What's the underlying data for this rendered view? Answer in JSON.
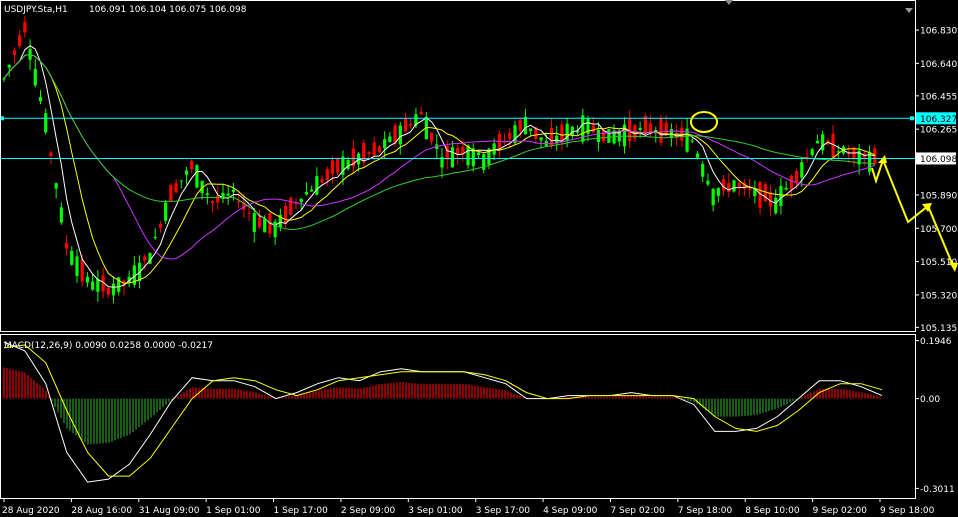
{
  "header": {
    "symbol": "USDJPY.Sta,H1",
    "ohlc": "106.091 106.104 106.075 106.098"
  },
  "colors": {
    "background": "#000000",
    "frame": "#ffffff",
    "bull": "#00ff00",
    "bear": "#ff0000",
    "line": "#00ffff",
    "ma_fast": "#ffffff",
    "ma_mid": "#ffff00",
    "ma_slow": "#cc33ff",
    "ma_long": "#33cc33",
    "arrow": "#ffff00",
    "circle": "#ffff00",
    "macd_up": "#cc0000",
    "macd_down": "#228822"
  },
  "chart_data": [
    {
      "type": "candlestick",
      "title": "USDJPY.Sta,H1",
      "price_ticks": [
        "106.830",
        "106.640",
        "106.455",
        "106.265",
        "106.098",
        "105.890",
        "105.700",
        "105.510",
        "105.320",
        "105.135"
      ],
      "ylim": [
        105.12,
        106.99
      ],
      "time_ticks": [
        "28 Aug 2020",
        "28 Aug 16:00",
        "31 Aug 09:00",
        "1 Sep 01:00",
        "1 Sep 17:00",
        "2 Sep 09:00",
        "3 Sep 01:00",
        "3 Sep 17:00",
        "4 Sep 09:00",
        "7 Sep 02:00",
        "7 Sep 18:00",
        "8 Sep 10:00",
        "9 Sep 02:00",
        "9 Sep 18:00"
      ],
      "horizontal_lines": [
        {
          "price": 106.327,
          "label": "106.327"
        },
        {
          "price": 106.098,
          "label": "106.098"
        }
      ],
      "annotations": [
        "yellow circle at 7 Sep 18:00 high",
        "yellow projection arrows after 9 Sep 18:00"
      ],
      "close_path": [
        [
          0,
          106.55
        ],
        [
          4,
          106.85
        ],
        [
          8,
          106.3
        ],
        [
          12,
          105.6
        ],
        [
          16,
          105.4
        ],
        [
          20,
          105.35
        ],
        [
          24,
          105.4
        ],
        [
          28,
          105.55
        ],
        [
          32,
          105.9
        ],
        [
          36,
          106.05
        ],
        [
          40,
          105.85
        ],
        [
          44,
          105.9
        ],
        [
          48,
          105.75
        ],
        [
          52,
          105.7
        ],
        [
          56,
          105.85
        ],
        [
          60,
          105.95
        ],
        [
          64,
          106.05
        ],
        [
          68,
          106.1
        ],
        [
          72,
          106.15
        ],
        [
          76,
          106.25
        ],
        [
          80,
          106.35
        ],
        [
          84,
          106.1
        ],
        [
          88,
          106.15
        ],
        [
          92,
          106.1
        ],
        [
          96,
          106.2
        ],
        [
          100,
          106.3
        ],
        [
          104,
          106.18
        ],
        [
          108,
          106.25
        ],
        [
          112,
          106.28
        ],
        [
          116,
          106.22
        ],
        [
          120,
          106.25
        ],
        [
          124,
          106.27
        ],
        [
          128,
          106.24
        ],
        [
          132,
          106.2
        ],
        [
          136,
          105.9
        ],
        [
          140,
          105.95
        ],
        [
          144,
          105.9
        ],
        [
          148,
          105.85
        ],
        [
          152,
          106.0
        ],
        [
          156,
          106.2
        ],
        [
          160,
          106.15
        ],
        [
          164,
          106.1
        ],
        [
          167,
          106.098
        ]
      ]
    },
    {
      "type": "line",
      "title": "MACD(12,26,9) 0.0090 0.0258 0.0000 -0.0217",
      "value_ticks": [
        "0.1946",
        "0.00",
        "-0.3011"
      ],
      "ylim": [
        -0.33,
        0.21
      ],
      "series": [
        {
          "values": [
            0.19,
            0.16,
            0.05,
            -0.18,
            -0.28,
            -0.27,
            -0.22,
            -0.12,
            -0.01,
            0.07,
            0.06,
            0.06,
            0.04,
            0.0,
            0.02,
            0.05,
            0.07,
            0.06,
            0.09,
            0.1,
            0.09,
            0.09,
            0.09,
            0.07,
            0.05,
            0.0,
            0.0,
            0.01,
            0.01,
            0.01,
            0.02,
            0.01,
            0.01,
            -0.02,
            -0.11,
            -0.11,
            -0.1,
            -0.06,
            0.0,
            0.06,
            0.06,
            0.04,
            0.01
          ]
        },
        {
          "values": [
            0.17,
            0.18,
            0.12,
            -0.04,
            -0.18,
            -0.26,
            -0.26,
            -0.2,
            -0.1,
            0.0,
            0.06,
            0.07,
            0.06,
            0.03,
            0.01,
            0.03,
            0.06,
            0.07,
            0.08,
            0.09,
            0.09,
            0.09,
            0.09,
            0.08,
            0.06,
            0.02,
            0.0,
            0.0,
            0.01,
            0.01,
            0.01,
            0.01,
            0.01,
            0.0,
            -0.06,
            -0.1,
            -0.11,
            -0.09,
            -0.04,
            0.02,
            0.05,
            0.05,
            0.03
          ]
        }
      ]
    }
  ]
}
